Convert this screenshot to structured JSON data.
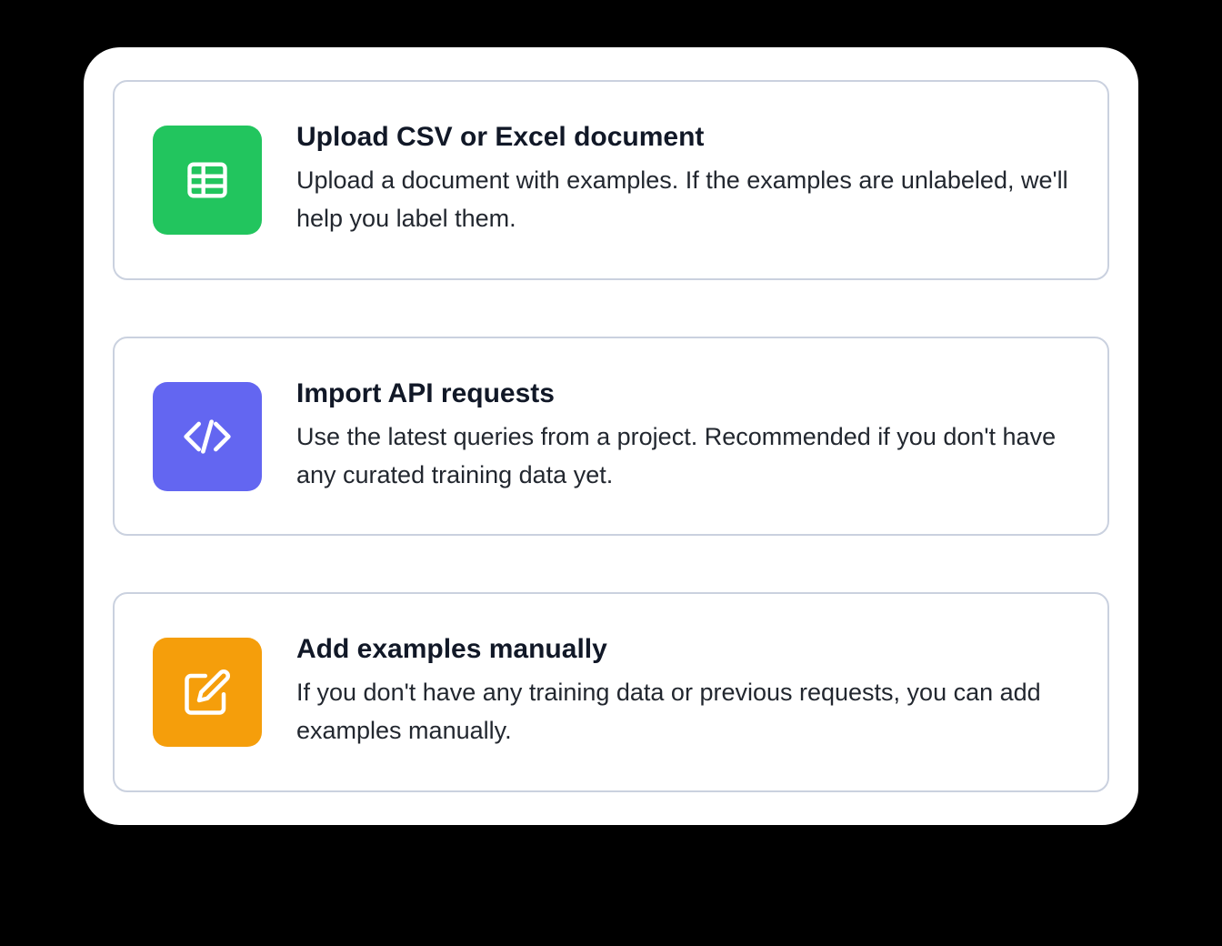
{
  "options": [
    {
      "title": "Upload CSV or Excel document",
      "description": "Upload a document with examples. If the examples are unlabeled, we'll help you label them.",
      "icon": "spreadsheet-icon",
      "icon_color": "#22c55e"
    },
    {
      "title": "Import API requests",
      "description": "Use the latest queries from a project. Recommended if you don't have any curated training data yet.",
      "icon": "code-icon",
      "icon_color": "#6366f1"
    },
    {
      "title": "Add examples manually",
      "description": "If you don't have any training data or previous requests, you can add examples manually.",
      "icon": "pencil-edit-icon",
      "icon_color": "#f59e0b"
    }
  ]
}
